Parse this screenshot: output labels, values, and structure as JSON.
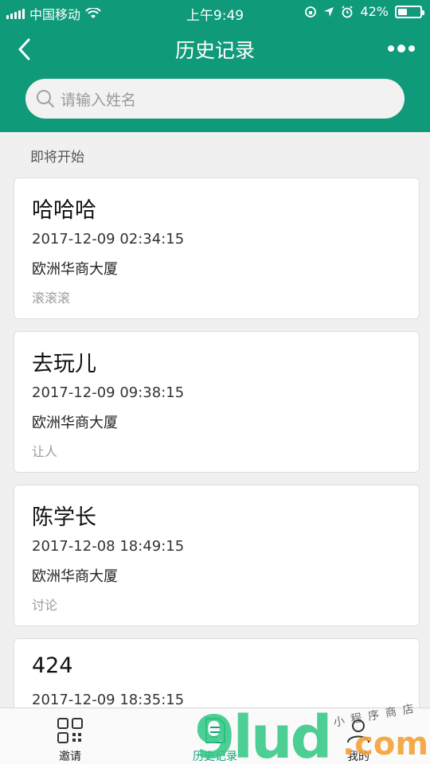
{
  "status_bar": {
    "carrier": "中国移动",
    "time": "上午9:49",
    "battery": "42%",
    "battery_level": 0.42
  },
  "nav": {
    "title": "历史记录"
  },
  "search": {
    "placeholder": "请输入姓名"
  },
  "section": {
    "label": "即将开始"
  },
  "records": [
    {
      "name": "哈哈哈",
      "time": "2017-12-09 02:34:15",
      "place": "欧洲华商大厦",
      "note": "滚滚滚"
    },
    {
      "name": "去玩儿",
      "time": "2017-12-09 09:38:15",
      "place": "欧洲华商大厦",
      "note": "让人"
    },
    {
      "name": "陈学长",
      "time": "2017-12-08 18:49:15",
      "place": "欧洲华商大厦",
      "note": "讨论"
    },
    {
      "name": "424",
      "time": "2017-12-09 18:35:15",
      "place": "",
      "note": ""
    }
  ],
  "tabs": [
    {
      "label": "邀请",
      "icon": "grid-icon"
    },
    {
      "label": "历史记录",
      "icon": "document-icon",
      "active": true
    },
    {
      "label": "我的",
      "icon": "person-icon"
    }
  ],
  "watermark": {
    "main": "9lud",
    "suffix": ".com",
    "tagline": "小程序商店"
  },
  "colors": {
    "primary": "#0f9a7a",
    "active_tab": "#12a07e"
  }
}
